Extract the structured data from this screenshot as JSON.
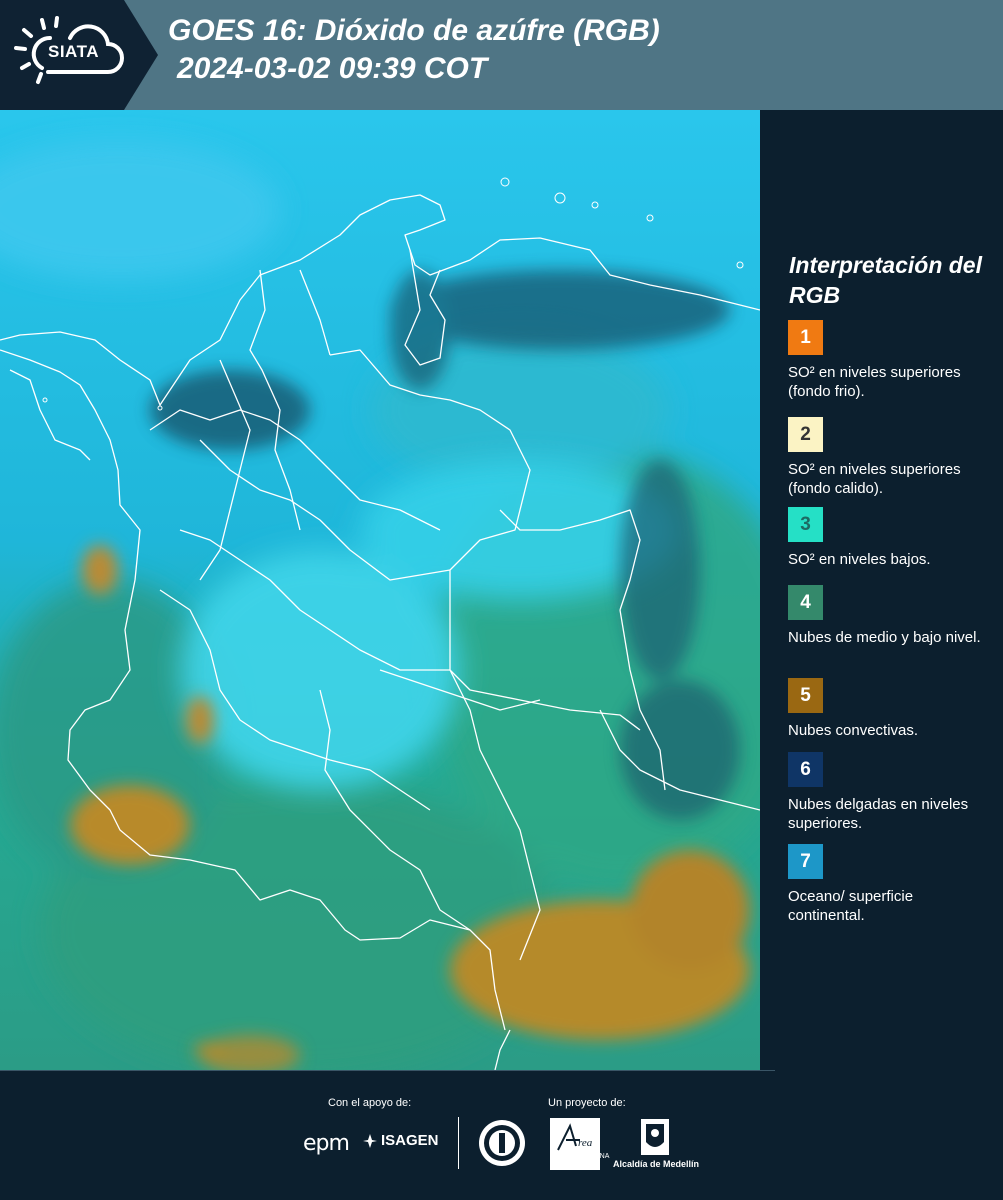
{
  "header": {
    "logo_text": "SIATA",
    "title_line1": "GOES 16: Dióxido de azúfre (RGB)",
    "title_line2": "2024-03-02 09:39 COT"
  },
  "map": {
    "colors": {
      "ocean": "#20b8e0",
      "land": "#2fa58d",
      "convective": "#b58a2a",
      "thin_clouds": "#124f66",
      "low_so2": "#27d3d6",
      "borders": "#ffffff"
    }
  },
  "legend": {
    "title": "Interpretación del RGB",
    "items": [
      {
        "number": "1",
        "label": "SO² en niveles superiores (fondo frio).",
        "color": "#f07a12",
        "text_color": "#ffffff"
      },
      {
        "number": "2",
        "label": "SO² en niveles superiores (fondo calido).",
        "color": "#fbf3c4",
        "text_color": "#333333"
      },
      {
        "number": "3",
        "label": "SO² en niveles bajos.",
        "color": "#25e0c6",
        "text_color": "#1d6b63"
      },
      {
        "number": "4",
        "label": "Nubes de medio y bajo nivel.",
        "color": "#34896b",
        "text_color": "#ffffff"
      },
      {
        "number": "5",
        "label": "Nubes convectivas.",
        "color": "#9a6812",
        "text_color": "#ffffff"
      },
      {
        "number": "6",
        "label": "Nubes delgadas en niveles superiores.",
        "color": "#0f3566",
        "text_color": "#ffffff"
      },
      {
        "number": "7",
        "label": "Oceano/ superficie continental.",
        "color": "#1d97c8",
        "text_color": "#ffffff"
      }
    ]
  },
  "footer": {
    "support_label": "Con el apoyo de:",
    "project_label": "Un proyecto de:",
    "epm": "epm",
    "isagen": "ISAGEN",
    "area_caption": "METROPOLITANA Valle de Aburrá",
    "alcaldia": "Alcaldía de Medellín"
  }
}
